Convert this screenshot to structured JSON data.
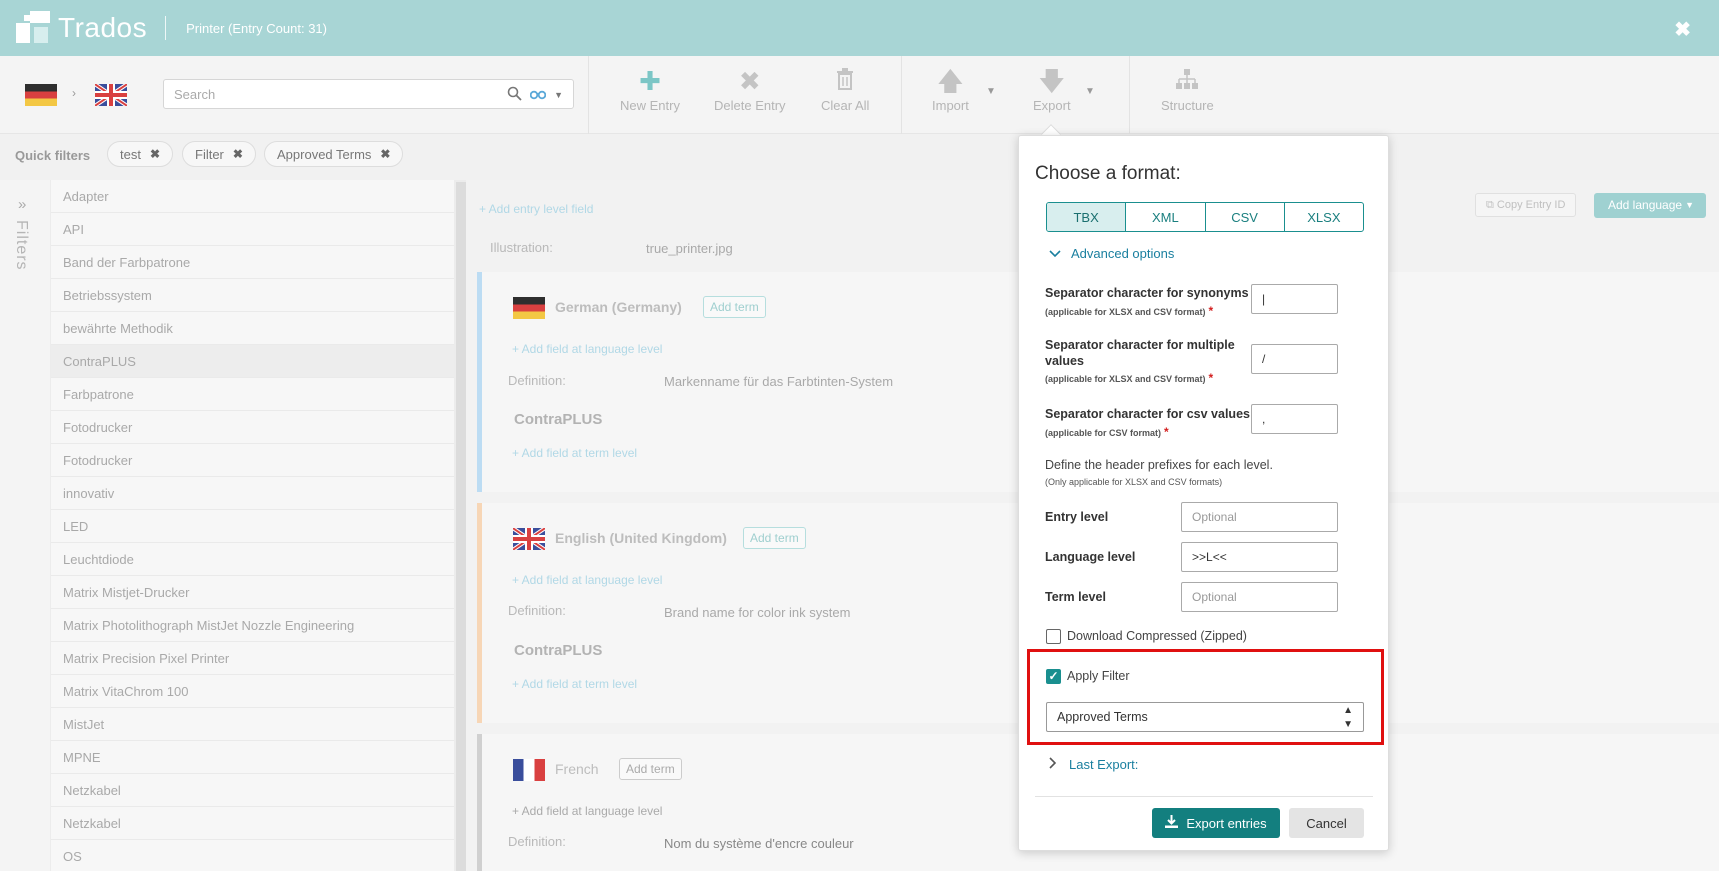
{
  "app": {
    "name": "Trados",
    "window_title": "Printer (Entry Count: 31)",
    "close": "✖"
  },
  "search": {
    "placeholder": "Search"
  },
  "toolbar": {
    "new_entry": "New Entry",
    "delete_entry": "Delete Entry",
    "clear_all": "Clear All",
    "import": "Import",
    "export": "Export",
    "structure": "Structure"
  },
  "quick_filters": {
    "label": "Quick filters",
    "chips": [
      "test",
      "Filter",
      "Approved Terms"
    ]
  },
  "filters_rail": {
    "label": "Filters"
  },
  "entries": [
    "Adapter",
    "API",
    "Band der Farbpatrone",
    "Betriebssystem",
    "bewährte Methodik",
    "ContraPLUS",
    "Farbpatrone",
    "Fotodrucker",
    "Fotodrucker",
    "innovativ",
    "LED",
    "Leuchtdiode",
    "Matrix Mistjet-Drucker",
    "Matrix Photolithograph MistJet Nozzle Engineering",
    "Matrix Precision Pixel Printer",
    "Matrix VitaChrom 100",
    "MistJet",
    "MPNE",
    "Netzkabel",
    "Netzkabel",
    "OS"
  ],
  "entry": {
    "add_entry_field": "+ Add entry level field",
    "illustration_label": "Illustration:",
    "illustration_value": "true_printer.jpg",
    "copy_entry_id": "Copy Entry ID",
    "add_language": "Add language",
    "add_term": "Add term",
    "add_field_lang": "+ Add field at language level",
    "add_field_term": "+ Add field at term level",
    "definition_label": "Definition:",
    "languages": [
      {
        "name": "German (Germany)",
        "definition": "Markenname für das Farbtinten-System",
        "term": "ContraPLUS",
        "color": "#bcdcf3"
      },
      {
        "name": "English (United Kingdom)",
        "definition": "Brand name for color ink system",
        "term": "ContraPLUS",
        "color": "#f7d6b6"
      },
      {
        "name": "French",
        "definition": "Nom du système d'encre couleur",
        "term": "",
        "color": "#d0d0d0"
      }
    ]
  },
  "dialog": {
    "title": "Choose a format:",
    "formats": [
      "TBX",
      "XML",
      "CSV",
      "XLSX"
    ],
    "selected_format": "TBX",
    "advanced_options": "Advanced options",
    "sep_synonyms_label": "Separator character for synonyms",
    "sep_synonyms_sub": "(applicable for XLSX and CSV format)",
    "sep_synonyms_value": "|",
    "sep_multi_label": "Separator character for multiple values",
    "sep_multi_sub": "(applicable for XLSX and CSV format)",
    "sep_multi_value": "/",
    "sep_csv_label": "Separator character for csv values",
    "sep_csv_sub": "(applicable for CSV format)",
    "sep_csv_value": ",",
    "required_mark": "*",
    "define_header": "Define the header prefixes for each level.",
    "define_header_sub": "(Only applicable for XLSX and CSV formats)",
    "entry_level_label": "Entry level",
    "entry_level_placeholder": "Optional",
    "language_level_label": "Language level",
    "language_level_value": ">>L<<",
    "term_level_label": "Term level",
    "term_level_placeholder": "Optional",
    "download_compressed": "Download Compressed (Zipped)",
    "apply_filter": "Apply Filter",
    "filter_selected": "Approved Terms",
    "last_export": "Last Export:",
    "export_button": "Export entries",
    "cancel_button": "Cancel"
  }
}
